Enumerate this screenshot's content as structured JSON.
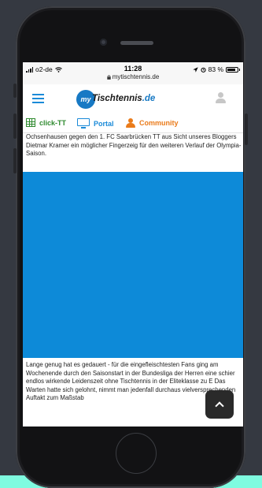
{
  "status_bar": {
    "carrier": "o2-de",
    "time": "11:28",
    "url": "mytischtennis.de",
    "battery": "83 %",
    "battery_level": 0.83
  },
  "header": {
    "logo_prefix": "my",
    "logo_name": "Tischtennis",
    "logo_suffix": ".de"
  },
  "tabs": [
    {
      "label": "click-TT",
      "color": "#2f8a2f",
      "icon": "grid-icon"
    },
    {
      "label": "Portal",
      "color": "#1a8ad8",
      "icon": "monitor-icon"
    },
    {
      "label": "Community",
      "color": "#ea7b1a",
      "icon": "person-icon"
    }
  ],
  "article": {
    "top_text": "Ochsenhausen gegen den 1. FC Saarbrücken TT aus Sicht unseres Bloggers Dietmar Kramer ein möglicher Fingerzeig für den weiteren Verlauf der Olympia-Saison.",
    "bottom_text": "Lange genug hat es gedauert - für die eingefleischtesten Fans ging am Wochenende durch den Saisonstart in der Bundesliga der Herren eine schier endlos wirkende Leidenszeit ohne Tischtennis in der Eliteklasse zu E Das Warten hatte sich gelohnt, nimmt man jedenfall durchaus vielversprechenden Auftakt zum Maßstab"
  },
  "colors": {
    "accent": "#1a8ad8",
    "media": "#0d8ad8",
    "background": "#353941"
  }
}
